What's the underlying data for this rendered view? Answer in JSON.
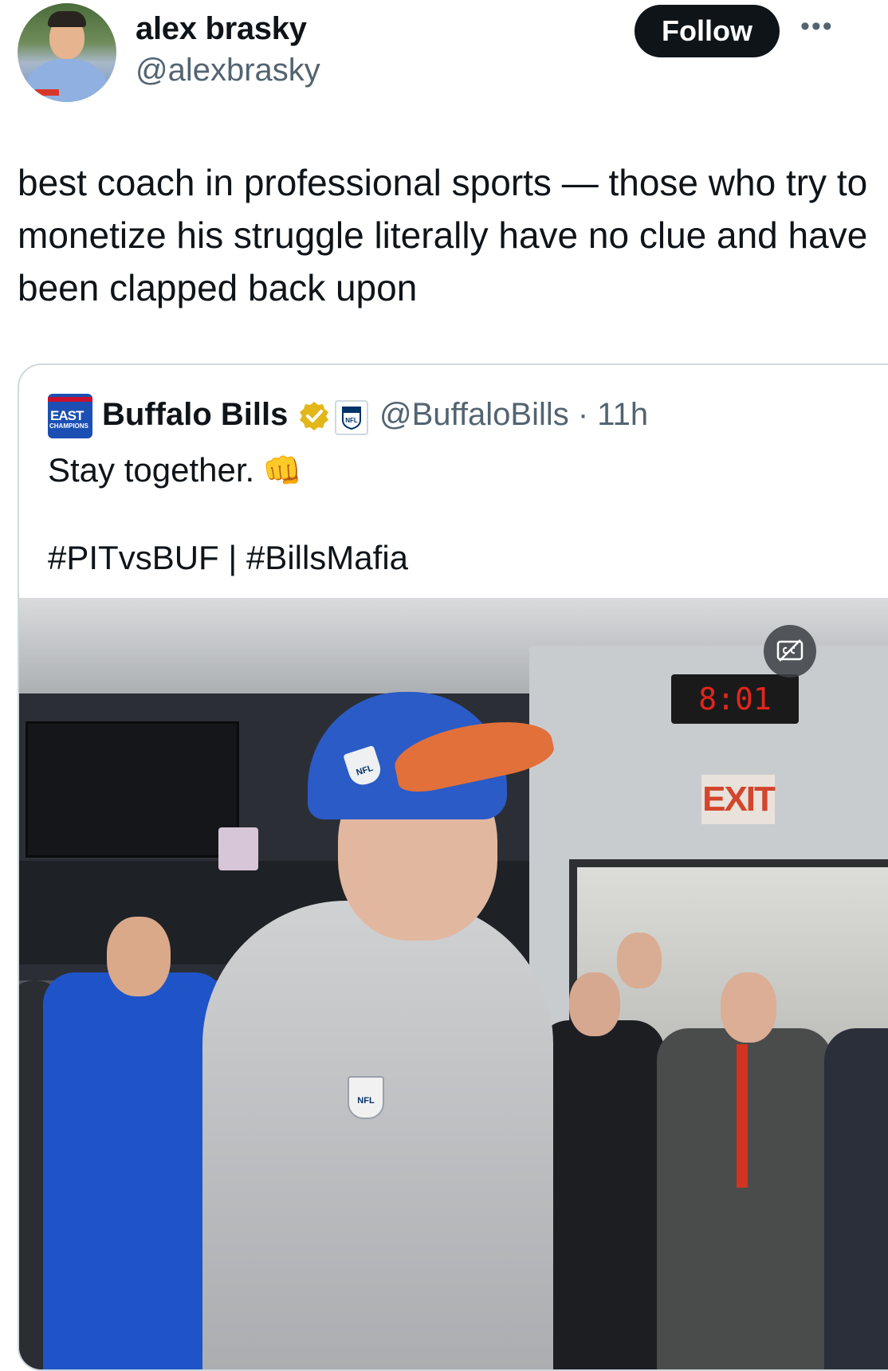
{
  "author": {
    "name": "alex brasky",
    "handle": "@alexbrasky",
    "avatar_icon": "user-avatar-photo"
  },
  "actions": {
    "follow_label": "Follow",
    "more_label": "•••"
  },
  "tweet": {
    "text": "best coach in professional sports — those who try to monetize his struggle literally have no clue and have been clapped back upon"
  },
  "quoted": {
    "name": "Buffalo Bills",
    "avatar_text_1": "EAST",
    "avatar_text_2": "CHAMPIONS",
    "meta": "@BuffaloBills · 11h",
    "text_line_1": "Stay together.",
    "emoji": "👊",
    "text_line_2": "#PITvsBUF | #BillsMafia",
    "verified_color": "#e2b719",
    "badge_text": "NFL",
    "media": {
      "clock_text": "8:01",
      "exit_text": "EXIT",
      "cap_logo_text": "NFL",
      "patch_text": "NFL",
      "captions_icon": "closed-captions-icon"
    }
  },
  "colors": {
    "accent_text": "#0f1419",
    "muted_text": "#536471",
    "border": "#cfd9de"
  }
}
